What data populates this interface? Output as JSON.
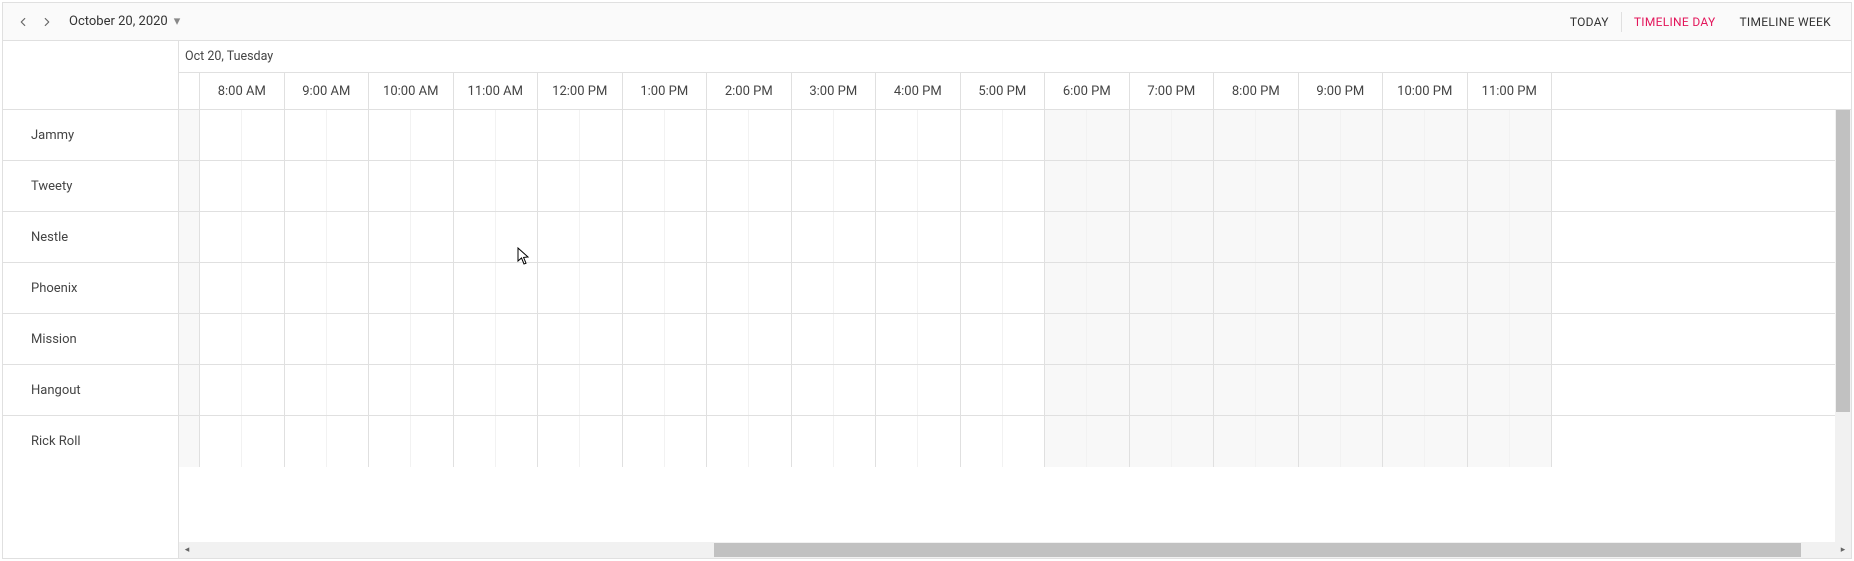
{
  "toolbar": {
    "date_label": "October 20, 2020",
    "today_label": "TODAY",
    "timeline_day_label": "TIMELINE DAY",
    "timeline_week_label": "TIMELINE WEEK",
    "active_view": "TIMELINE DAY"
  },
  "header": {
    "day_label": "Oct 20, Tuesday"
  },
  "time_slots": [
    "8:00 AM",
    "9:00 AM",
    "10:00 AM",
    "11:00 AM",
    "12:00 PM",
    "1:00 PM",
    "2:00 PM",
    "3:00 PM",
    "4:00 PM",
    "5:00 PM",
    "6:00 PM",
    "7:00 PM",
    "8:00 PM",
    "9:00 PM",
    "10:00 PM",
    "11:00 PM"
  ],
  "resources": [
    {
      "name": "Jammy"
    },
    {
      "name": "Tweety"
    },
    {
      "name": "Nestle"
    },
    {
      "name": "Phoenix"
    },
    {
      "name": "Mission"
    },
    {
      "name": "Hangout"
    },
    {
      "name": "Rick Roll"
    }
  ],
  "shaded_columns_start_index": 10,
  "icons": {
    "prev": "chevron-left-icon",
    "next": "chevron-right-icon",
    "caret": "caret-down-icon"
  }
}
